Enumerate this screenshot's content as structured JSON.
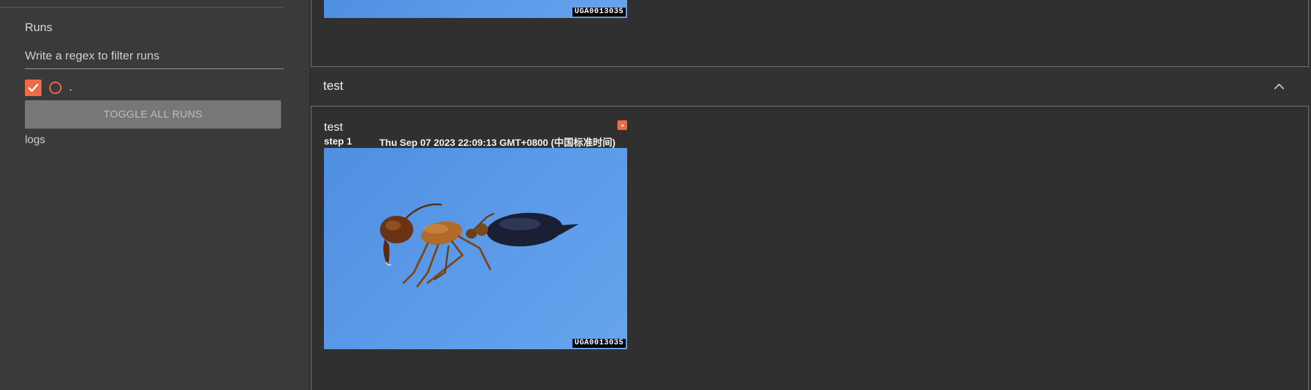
{
  "sidebar": {
    "runs_title": "Runs",
    "filter_placeholder": "Write a regex to filter runs",
    "run": {
      "label": ".",
      "checked": true
    },
    "toggle_all_label": "TOGGLE ALL RUNS",
    "logs_label": "logs"
  },
  "main": {
    "top_card": {
      "watermark": "UGA0013035"
    },
    "section": {
      "title": "test"
    },
    "image_card": {
      "title": "test",
      "step_label": "step",
      "step_value": "1",
      "timestamp": "Thu Sep 07 2023 22:09:13 GMT+0800 (中国标准时间)",
      "watermark": "UGA0013035"
    }
  },
  "colors": {
    "accent": "#f06b43",
    "background": "#303030",
    "sidebar": "#3a3a3a",
    "image_blue": "#5b9ae8"
  },
  "icons": {
    "collapse": "chevron-up-icon",
    "checkbox": "checkmark-icon",
    "run_color": "radio-circle-icon"
  }
}
